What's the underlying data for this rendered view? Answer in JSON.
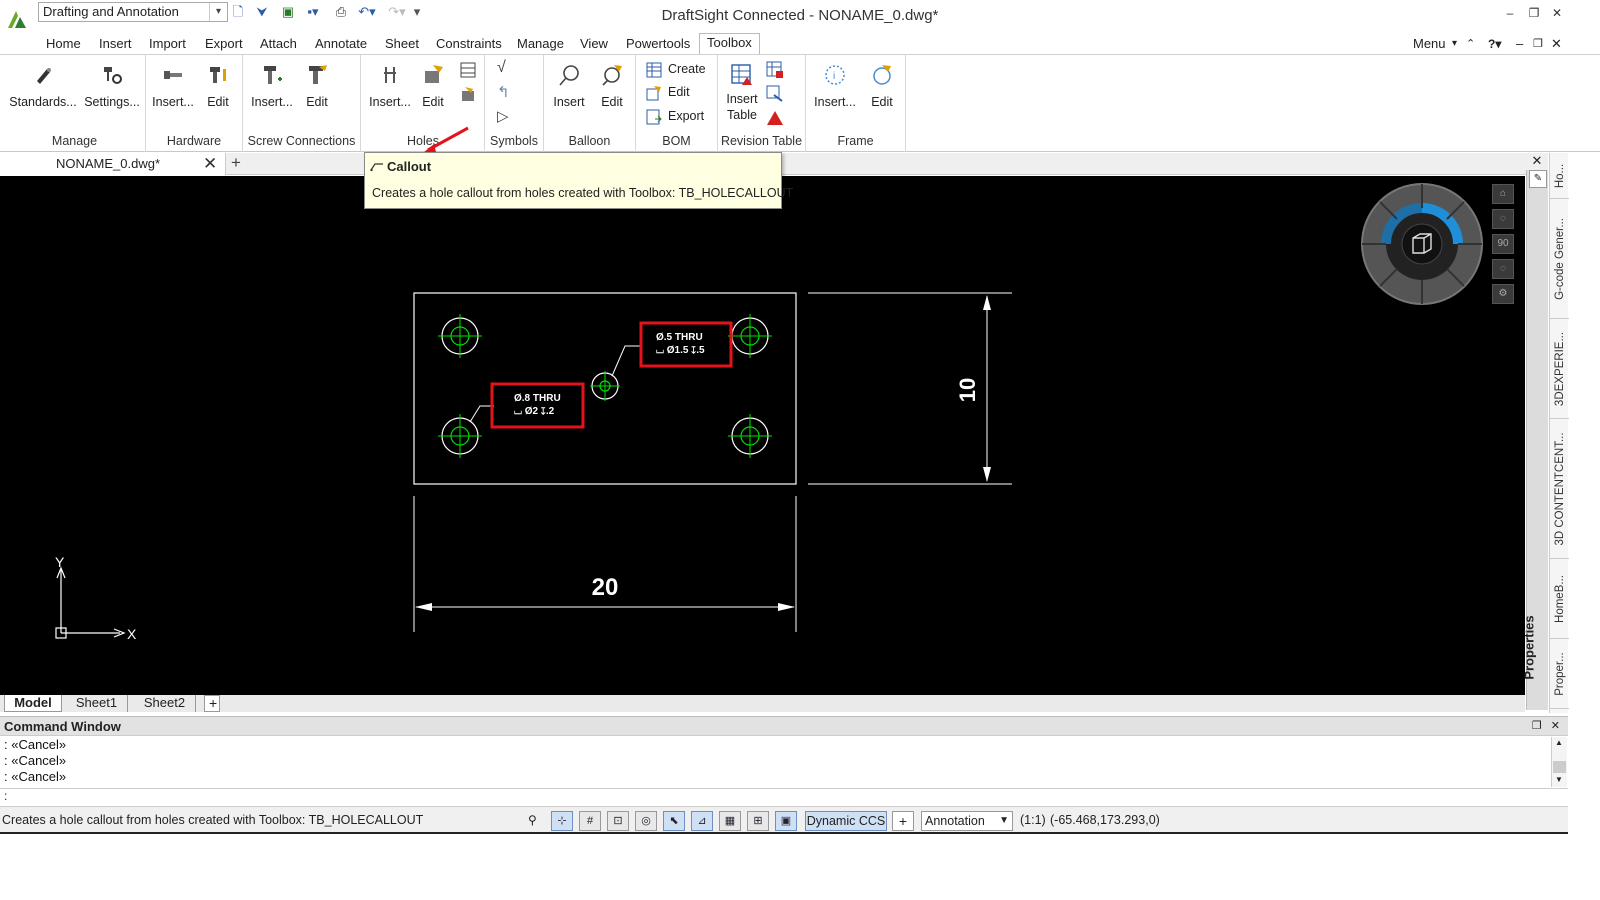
{
  "app": {
    "window_title": "DraftSight Connected - NONAME_0.dwg*",
    "workspace": "Drafting and Annotation"
  },
  "menubar": {
    "items": [
      "Home",
      "Insert",
      "Import",
      "Export",
      "Attach",
      "Annotate",
      "Sheet",
      "Constraints",
      "Manage",
      "View",
      "Powertools",
      "Toolbox"
    ],
    "active": "Toolbox",
    "menu_label": "Menu"
  },
  "ribbon": {
    "manage": {
      "label": "Manage",
      "standards": "Standards...",
      "settings": "Settings..."
    },
    "hardware": {
      "label": "Hardware",
      "insert": "Insert...",
      "edit": "Edit"
    },
    "screw": {
      "label": "Screw Connections",
      "insert": "Insert...",
      "edit": "Edit"
    },
    "holes": {
      "label": "Holes",
      "insert": "Insert...",
      "edit": "Edit"
    },
    "symbols": {
      "label": "Symbols"
    },
    "balloon": {
      "label": "Balloon",
      "insert": "Insert",
      "edit": "Edit"
    },
    "bom": {
      "label": "BOM",
      "create": "Create",
      "edit": "Edit",
      "export": "Export"
    },
    "revision": {
      "label": "Revision Table",
      "insert_line1": "Insert",
      "insert_line2": "Table"
    },
    "frame": {
      "label": "Frame",
      "insert": "Insert...",
      "edit": "Edit"
    }
  },
  "doc_tab": {
    "label": "NONAME_0.dwg*"
  },
  "tooltip": {
    "title": "Callout",
    "description": "Creates a hole callout from holes created with Toolbox: TB_HOLECALLOUT"
  },
  "drawing": {
    "callout_a_line1": "Ø.5 THRU",
    "callout_a_line2": "⌴ Ø1.5 ↧.5",
    "callout_b_line1": "Ø.8 THRU",
    "callout_b_line2": "⌴ Ø2 ↧.2",
    "dim_width": "20",
    "dim_height": "10",
    "axis_x": "X",
    "axis_y": "Y"
  },
  "navcube": {
    "zoom_label": "90"
  },
  "right_panel": {
    "properties": "Properties",
    "tabs": [
      "Ho...",
      "G-code Gener...",
      "3DEXPERIE...",
      "3D CONTENTCENT...",
      "HomeB...",
      "Proper..."
    ]
  },
  "layout_tabs": {
    "model": "Model",
    "sheet1": "Sheet1",
    "sheet2": "Sheet2"
  },
  "command_window": {
    "title": "Command Window",
    "lines": [
      ": «Cancel»",
      ": «Cancel»",
      ": «Cancel»"
    ],
    "prompt": ":"
  },
  "statusbar": {
    "message": "Creates a hole callout from holes created with Toolbox: TB_HOLECALLOUT",
    "dynamic_ccs": "Dynamic CCS",
    "annotation": "Annotation",
    "scale": "(1:1)",
    "coordinates": "(-65.468,173.293,0)"
  },
  "colors": {
    "canvas": "#000000",
    "highlight": "#e3121b",
    "hole_center": "#00e000",
    "tooltip_bg": "#ffffe1"
  }
}
